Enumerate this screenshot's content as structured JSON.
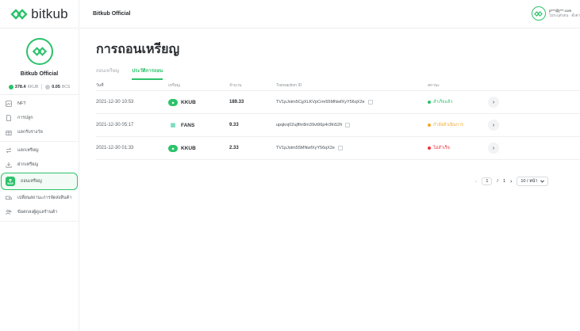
{
  "brand": {
    "name": "bitkub",
    "accent": "#2cc26a"
  },
  "profile": {
    "name": "Bitkub Official",
    "balances": [
      {
        "amount": "378.4",
        "unit": "KKUB",
        "color": "#2cc26a"
      },
      {
        "amount": "0.05",
        "unit": "BCS",
        "color": "#c9cdd1"
      }
    ]
  },
  "sidebar": {
    "items": [
      {
        "label": "NFT",
        "icon": "image-icon"
      },
      {
        "label": "การปลูก",
        "icon": "document-icon"
      },
      {
        "label": "แลกรับรางวัล",
        "icon": "gift-icon"
      },
      {
        "label": "แลกเหรียญ",
        "icon": "swap-icon"
      },
      {
        "label": "ฝากเหรียญ",
        "icon": "deposit-icon"
      },
      {
        "label": "ถอนเหรียญ",
        "icon": "withdraw-icon",
        "active": true
      },
      {
        "label": "เปลี่ยนสถานะการจัดส่งสินค้า",
        "icon": "truck-icon"
      },
      {
        "label": "ข้อตกลงผู้ดูแลร้านค้า",
        "icon": "users-icon"
      }
    ]
  },
  "topbar": {
    "title": "Bitkub Official",
    "user_email": "p***@j***.com",
    "user_sub": "ไม่ระบุตัวตน · ตั้งค่า"
  },
  "main": {
    "title": "การถอนเหรียญ",
    "tabs": [
      {
        "label": "ถอนเหรียญ",
        "active": false
      },
      {
        "label": "ประวัติการถอน",
        "active": true
      }
    ],
    "columns": [
      "วันที่",
      "เหรียญ",
      "จำนวน",
      "Transaction ID",
      "สถานะ"
    ],
    "rows": [
      {
        "date": "2021-12-30 10:53",
        "coin": "KKUB",
        "coin_color": "#2cc26a",
        "amount": "189.33",
        "tx": "TV1pJstm5CgXLKVpCrm55MNwfXyY56qX2e",
        "status": "สำเร็จแล้ว",
        "status_color": "#2cc26a"
      },
      {
        "date": "2021-12-30 05:17",
        "coin": "FANS",
        "coin_color": "#35c9a0",
        "amount": "9.33",
        "tx": "upqknj02ujflhr8m39vt96p4r3fn52fr",
        "status": "กำลังดำเนินการ",
        "status_color": "#f5a623"
      },
      {
        "date": "2021-12-30 01:33",
        "coin": "KKUB",
        "coin_color": "#2cc26a",
        "amount": "2.33",
        "tx": "TV1pJstm55MNwfXyY56qX2e",
        "status": "ไม่สำเร็จ",
        "status_color": "#f0323c"
      }
    ],
    "pagination": {
      "current": "1",
      "separator": "/",
      "total": "1",
      "page_size": "10 / หน้า"
    }
  }
}
